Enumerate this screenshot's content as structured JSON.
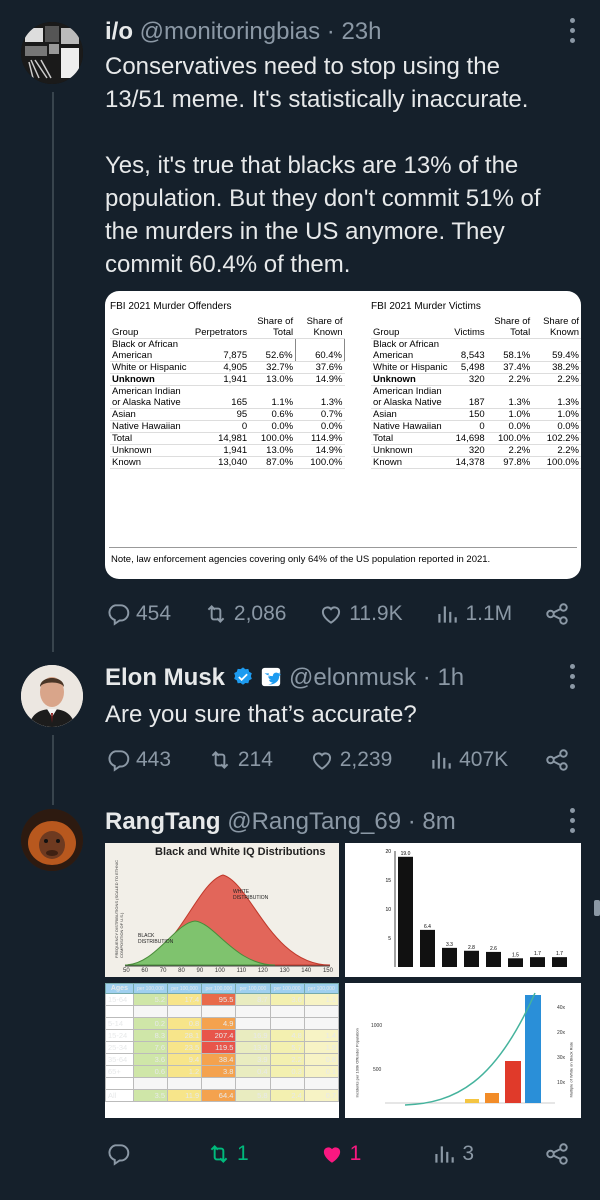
{
  "tweet1": {
    "name": "i/o",
    "handle": "@monitoringbias",
    "time": "· 23h",
    "text": "Conservatives need to stop using the 13/51 meme. It's statistically inaccurate.\n\nYes, it's true that blacks are 13% of the population. But they don't commit 51% of the murders in the US anymore. They commit 60.4% of them.",
    "lines": [
      "Conservatives need to stop using the",
      "13/51 meme. It's statistically inaccurate.",
      "",
      "Yes, it's true that blacks are 13% of the",
      "population. But they don't commit 51% of",
      "the murders in the US anymore. They",
      "commit 60.4% of them."
    ],
    "image": {
      "offenders": {
        "title": "FBI 2021 Murder Offenders",
        "headers": [
          "Group",
          "Perpetrators",
          "Share of Total",
          "Share of Known"
        ],
        "rows": [
          [
            "Black or African American",
            "7,875",
            "52.6%",
            "60.4%"
          ],
          [
            "White or Hispanic",
            "4,905",
            "32.7%",
            "37.6%"
          ],
          [
            "Unknown",
            "1,941",
            "13.0%",
            "14.9%"
          ],
          [
            "American Indian or Alaska Native",
            "165",
            "1.1%",
            "1.3%"
          ],
          [
            "Asian",
            "95",
            "0.6%",
            "0.7%"
          ],
          [
            "Native Hawaiian",
            "0",
            "0.0%",
            "0.0%"
          ],
          [
            "Total",
            "14,981",
            "100.0%",
            "114.9%"
          ],
          [
            "Unknown",
            "1,941",
            "13.0%",
            "14.9%"
          ],
          [
            "Known",
            "13,040",
            "87.0%",
            "100.0%"
          ]
        ]
      },
      "victims": {
        "title": "FBI 2021 Murder Victims",
        "headers": [
          "Group",
          "Victims",
          "Share of Total",
          "Share of Known"
        ],
        "rows": [
          [
            "Black or African American",
            "8,543",
            "58.1%",
            "59.4%"
          ],
          [
            "White or Hispanic",
            "5,498",
            "37.4%",
            "38.2%"
          ],
          [
            "Unknown",
            "320",
            "2.2%",
            "2.2%"
          ],
          [
            "American Indian or Alaska Native",
            "187",
            "1.3%",
            "1.3%"
          ],
          [
            "Asian",
            "150",
            "1.0%",
            "1.0%"
          ],
          [
            "Native Hawaiian",
            "0",
            "0.0%",
            "0.0%"
          ],
          [
            "Total",
            "14,698",
            "100.0%",
            "102.2%"
          ],
          [
            "Unknown",
            "320",
            "2.2%",
            "2.2%"
          ],
          [
            "Known",
            "14,378",
            "97.8%",
            "100.0%"
          ]
        ]
      },
      "note": "Note, law enforcement agencies covering only 64% of the US population reported in 2021."
    },
    "stats": {
      "replies": "454",
      "retweets": "2,086",
      "likes": "11.9K",
      "views": "1.1M"
    }
  },
  "tweet2": {
    "name": "Elon Musk",
    "handle": "@elonmusk",
    "time": "· 1h",
    "text": "Are you sure that’s accurate?",
    "stats": {
      "replies": "443",
      "retweets": "214",
      "likes": "2,239",
      "views": "407K"
    }
  },
  "tweet3": {
    "name": "RangTang",
    "handle": "@RangTang_69",
    "time": "· 8m",
    "iq_chart": {
      "title": "Black and White IQ Distributions",
      "label_white": "WHITE DISTRIBUTION",
      "label_black": "BLACK DISTRIBUTION",
      "ylabel": "FREQUENCY DISTRIBUTIONS (SCALED TO ETHNIC COMPOSITION OF U.S.)",
      "x_ticks": [
        "50",
        "60",
        "70",
        "80",
        "90",
        "100",
        "110",
        "120",
        "130",
        "140",
        "150"
      ]
    },
    "bar_chart": {
      "values": [
        19.0,
        6.4,
        3.3,
        2.8,
        2.6,
        1.5,
        1.7,
        1.7
      ],
      "labels": [
        "19.0",
        "6.4",
        "3.3",
        "2.8",
        "2.6",
        "1.5",
        "1.7",
        "1.7"
      ],
      "y_ticks": [
        "20",
        "15",
        "10",
        "5"
      ]
    },
    "rate_table": {
      "headers": [
        "Ages",
        "per 100,000",
        "per 100,000",
        "per 100,000",
        "per 100,000",
        "per 100,000",
        "per 100,000"
      ],
      "rows": [
        [
          "15-64",
          "5.2",
          "17.4",
          "95.5",
          "8.7",
          "3.6",
          "1.1"
        ],
        [
          "",
          "",
          "",
          "",
          "",
          "",
          ""
        ],
        [
          "5-14",
          "0.2",
          "0.8",
          "4.9",
          "",
          "",
          ""
        ],
        [
          "15-24",
          "8.3",
          "28.1",
          "207.4",
          "16.9",
          "4.8",
          "1.4"
        ],
        [
          "25-34",
          "7.6",
          "23.5",
          "119.5",
          "13.3",
          "5.7",
          "1.9"
        ],
        [
          "35-64",
          "3.6",
          "9.4",
          "38.4",
          "3.9",
          "2.2",
          "0.8"
        ],
        [
          "65+",
          "0.6",
          "1.2",
          "3.8",
          "0.4",
          "0.3",
          "0.1"
        ],
        [
          "",
          "",
          "",
          "",
          "",
          "",
          ""
        ],
        [
          "All",
          "3.5",
          "11.9",
          "64.4",
          "5.8",
          "2.4",
          "0.7"
        ]
      ]
    },
    "last_chart": {
      "ylabel_left": "Incidents per 100k Offender Population",
      "ylabel_right": "Multiple of White on Black Rate",
      "y_ticks_left": [
        "1000",
        "500"
      ],
      "y_ticks_right": [
        "40x",
        "20x",
        "30x",
        "10x"
      ]
    },
    "stats": {
      "replies": "",
      "retweets": "1",
      "likes": "1",
      "views": "3"
    }
  },
  "colors": {
    "background": "#15202b",
    "text": "#e7e9ea",
    "muted": "#8b98a5",
    "verified": "#1d9bf0",
    "retweeted": "#00ba7c",
    "liked": "#f91880"
  }
}
